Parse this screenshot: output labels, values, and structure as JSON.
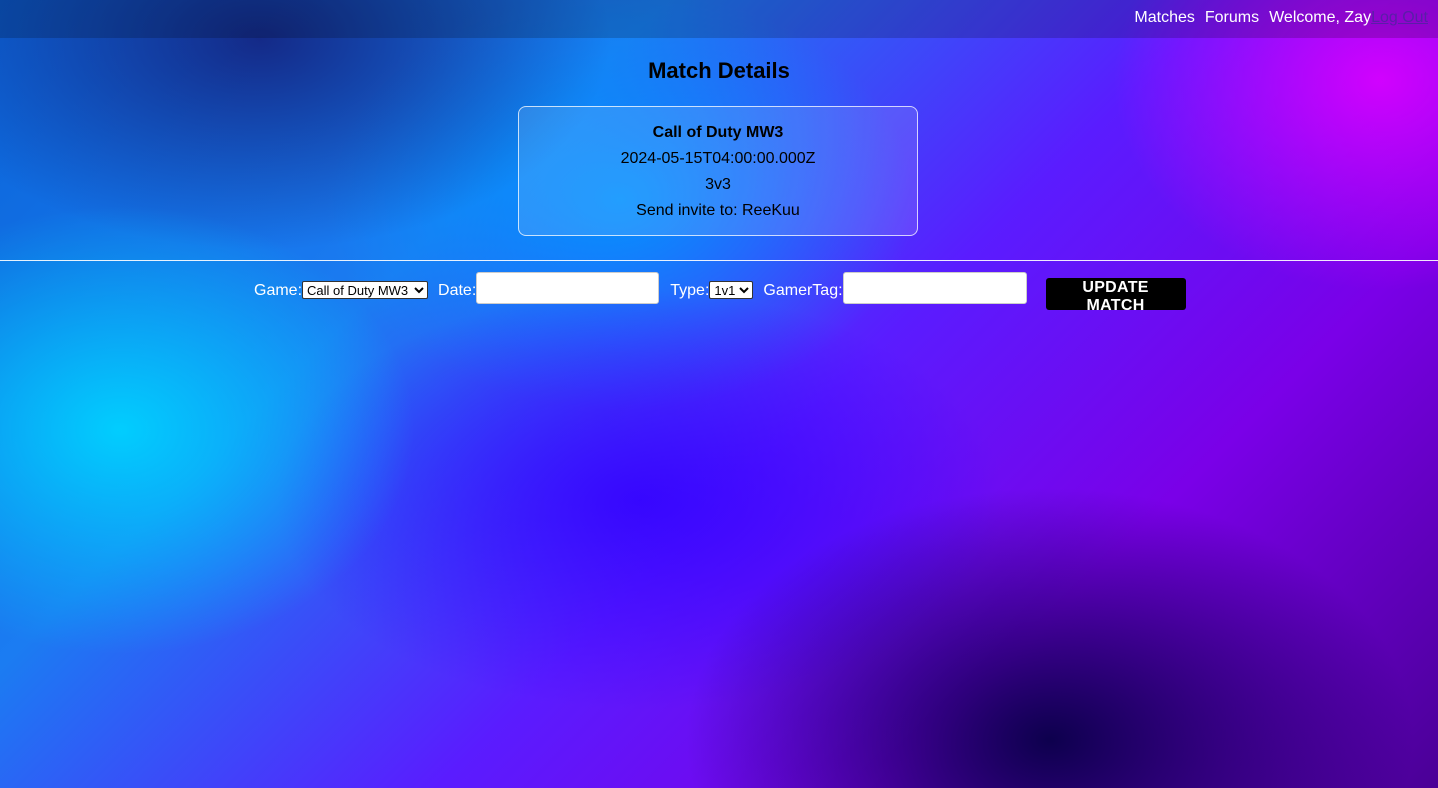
{
  "nav": {
    "matches": "Matches",
    "forums": "Forums",
    "welcome": "Welcome, Zay",
    "logout": "Log Out"
  },
  "page": {
    "title": "Match Details"
  },
  "match": {
    "game": "Call of Duty MW3",
    "date": "2024-05-15T04:00:00.000Z",
    "type": "3v3",
    "invite": "Send invite to: ReeKuu"
  },
  "form": {
    "game_label": "Game:",
    "game_selected": "Call of Duty MW3",
    "date_label": "Date:",
    "date_value": "",
    "type_label": "Type:",
    "type_selected": "1v1",
    "gamertag_label": "GamerTag:",
    "gamertag_value": "",
    "submit_label": "UPDATE MATCH"
  }
}
